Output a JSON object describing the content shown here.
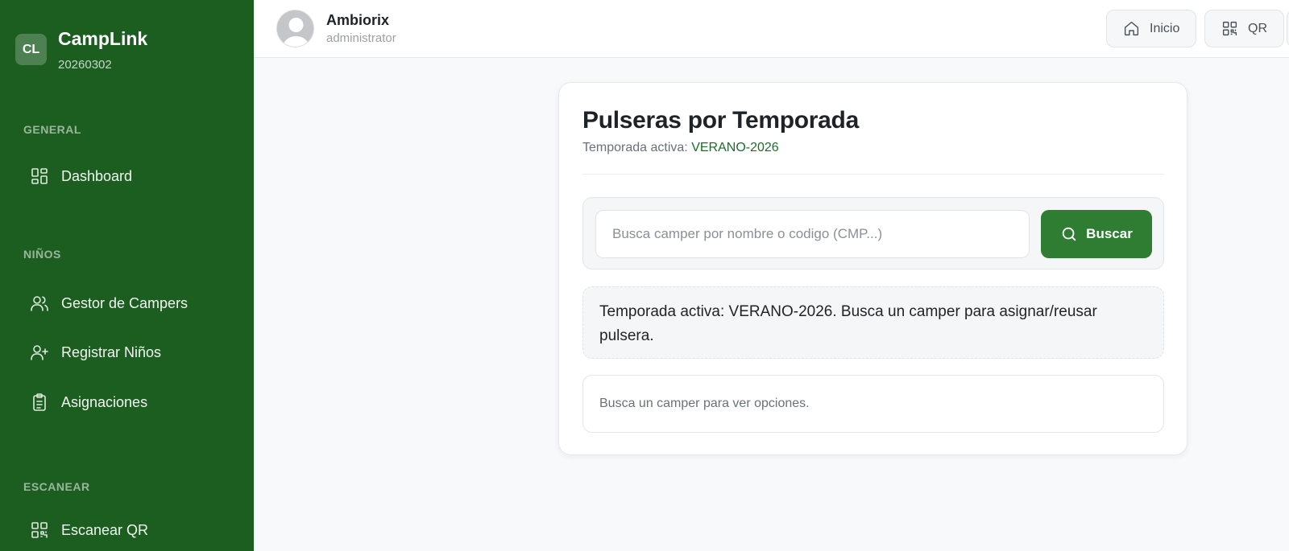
{
  "brand": {
    "badge": "CL",
    "name": "CampLink",
    "code": "20260302"
  },
  "sidebar": {
    "sections": [
      {
        "label": "GENERAL"
      },
      {
        "label": "NIÑOS"
      },
      {
        "label": "ESCANEAR"
      }
    ],
    "items": [
      {
        "label": "Dashboard",
        "icon": "dashboard-icon"
      },
      {
        "label": "Gestor de Campers",
        "icon": "users-icon"
      },
      {
        "label": "Registrar Niños",
        "icon": "user-plus-icon"
      },
      {
        "label": "Asignaciones",
        "icon": "clipboard-icon"
      },
      {
        "label": "Escanear QR",
        "icon": "qr-icon"
      }
    ]
  },
  "topbar": {
    "user_name": "Ambiorix",
    "user_role": "administrator",
    "home_label": "Inicio",
    "qr_label": "QR"
  },
  "main": {
    "title": "Pulseras por Temporada",
    "season_prefix": "Temporada activa:",
    "season_value": "VERANO-2026",
    "search": {
      "value": "",
      "placeholder": "Busca camper por nombre o codigo (CMP...)",
      "button_label": "Buscar"
    },
    "notice": "Temporada activa: VERANO-2026. Busca un camper para asignar/reusar pulsera.",
    "result_hint": "Busca un camper para ver opciones."
  },
  "colors": {
    "sidebar_bg": "#1b5e20",
    "accent": "#2e7d32",
    "accent_text": "#1b6e2a"
  }
}
